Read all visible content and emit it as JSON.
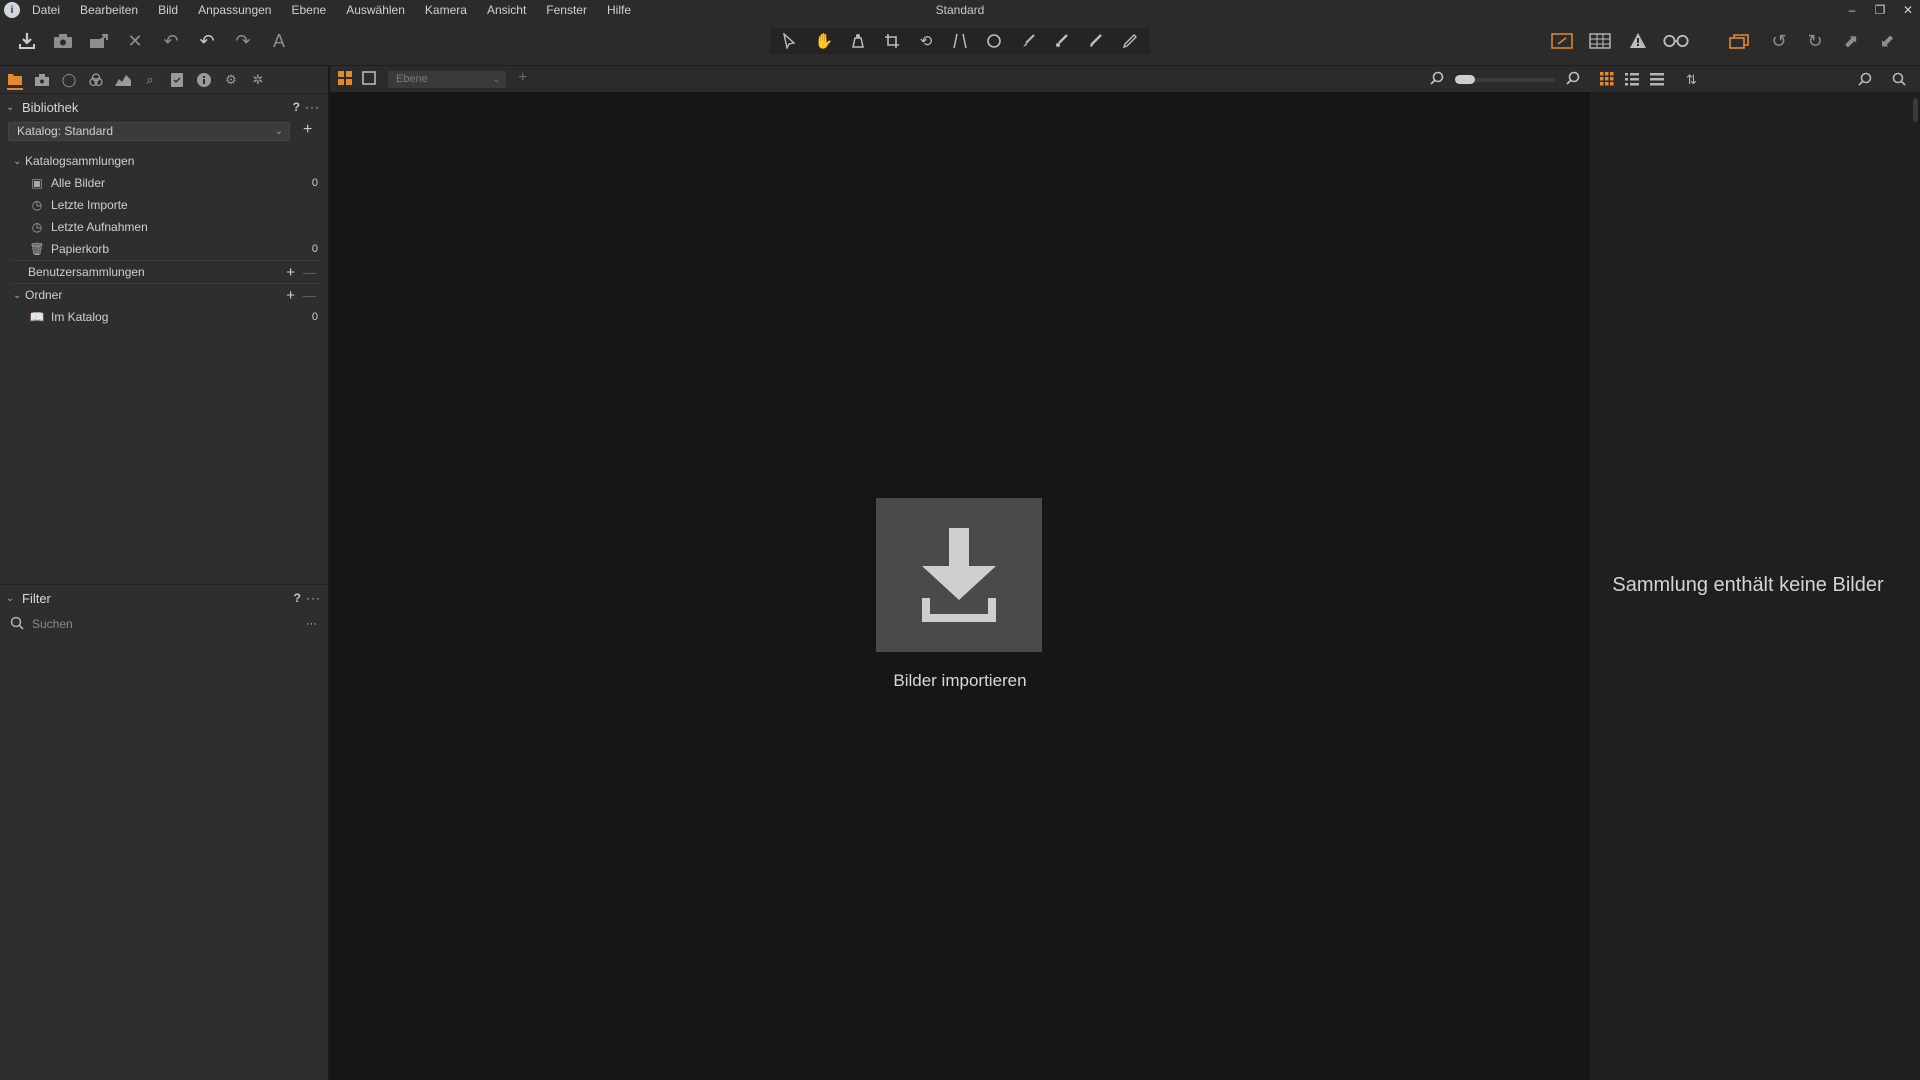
{
  "window": {
    "title": "Standard"
  },
  "menu": [
    "Datei",
    "Bearbeiten",
    "Bild",
    "Anpassungen",
    "Ebene",
    "Auswählen",
    "Kamera",
    "Ansicht",
    "Fenster",
    "Hilfe"
  ],
  "left_panel": {
    "library": {
      "title": "Bibliothek",
      "help": "?",
      "more": "···",
      "catalog_select": "Katalog: Standard",
      "groups": {
        "catalog_collections": {
          "label": "Katalogsammlungen",
          "items": [
            {
              "label": "Alle Bilder",
              "count": "0",
              "icon": "images-icon"
            },
            {
              "label": "Letzte Importe",
              "count": "",
              "icon": "clock-icon"
            },
            {
              "label": "Letzte Aufnahmen",
              "count": "",
              "icon": "clock-icon"
            },
            {
              "label": "Papierkorb",
              "count": "0",
              "icon": "trash-icon"
            }
          ]
        },
        "user_collections": {
          "label": "Benutzersammlungen"
        },
        "folders": {
          "label": "Ordner",
          "items": [
            {
              "label": "Im Katalog",
              "count": "0",
              "icon": "book-icon"
            }
          ]
        }
      }
    },
    "filter": {
      "title": "Filter",
      "help": "?",
      "more": "···",
      "search_placeholder": "Suchen",
      "search_more": "···"
    }
  },
  "viewer": {
    "layer_select": "Ebene",
    "import_label": "Bilder importieren"
  },
  "browser": {
    "empty_text": "Sammlung enthält keine Bilder"
  },
  "colors": {
    "accent": "#e38b2c",
    "panel": "#2e2e2e",
    "viewer": "#161616",
    "browser": "#1f1f1f"
  }
}
